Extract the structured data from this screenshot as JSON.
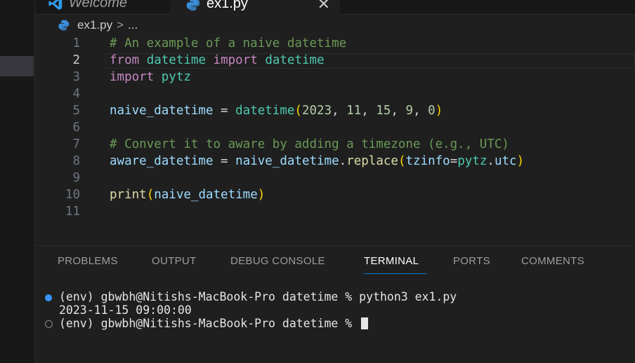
{
  "tabs": [
    {
      "label": "Welcome",
      "icon": "vscode-logo-icon"
    },
    {
      "label": "ex1.py",
      "icon": "python-file-icon",
      "close": "✕"
    }
  ],
  "breadcrumb": {
    "file": "ex1.py",
    "sep": ">",
    "more": "..."
  },
  "editor": {
    "current_line": 2,
    "lines": [
      {
        "n": "1"
      },
      {
        "n": "2"
      },
      {
        "n": "3"
      },
      {
        "n": "4"
      },
      {
        "n": "5"
      },
      {
        "n": "6"
      },
      {
        "n": "7"
      },
      {
        "n": "8"
      },
      {
        "n": "9"
      },
      {
        "n": "10"
      },
      {
        "n": "11"
      }
    ],
    "tokens": {
      "l1_comment": "# An example of a naive datetime",
      "l2_from": "from",
      "l2_mod": "datetime",
      "l2_import": "import",
      "l2_cls": "datetime",
      "l3_import": "import",
      "l3_mod": "pytz",
      "l5_var": "naive_datetime",
      "l5_eq": " = ",
      "l5_fn": "datetime",
      "l5_open": "(",
      "l5_a1": "2023",
      "l5_a2": "11",
      "l5_a3": "15",
      "l5_a4": "9",
      "l5_a5": "0",
      "l5_comma": ", ",
      "l5_close": ")",
      "l7_comment": "# Convert it to aware by adding a timezone (e.g., UTC)",
      "l8_var": "aware_datetime",
      "l8_eq": " = ",
      "l8_obj": "naive_datetime",
      "l8_dot": ".",
      "l8_fn": "replace",
      "l8_open": "(",
      "l8_kw": "tzinfo",
      "l8_kweq": "=",
      "l8_mod": "pytz",
      "l8_dot2": ".",
      "l8_attr": "utc",
      "l8_close": ")",
      "l10_fn": "print",
      "l10_open": "(",
      "l10_arg": "naive_datetime",
      "l10_close": ")"
    }
  },
  "panel": {
    "tabs": [
      "PROBLEMS",
      "OUTPUT",
      "DEBUG CONSOLE",
      "TERMINAL",
      "PORTS",
      "COMMENTS"
    ],
    "active": "TERMINAL"
  },
  "terminal": {
    "lines": [
      "(env) gbwbh@Nitishs-MacBook-Pro datetime % python3 ex1.py",
      "2023-11-15 09:00:00",
      "(env) gbwbh@Nitishs-MacBook-Pro datetime % "
    ]
  },
  "colors": {
    "accent": "#0078d4",
    "terminal_dot": "#3794ff"
  }
}
